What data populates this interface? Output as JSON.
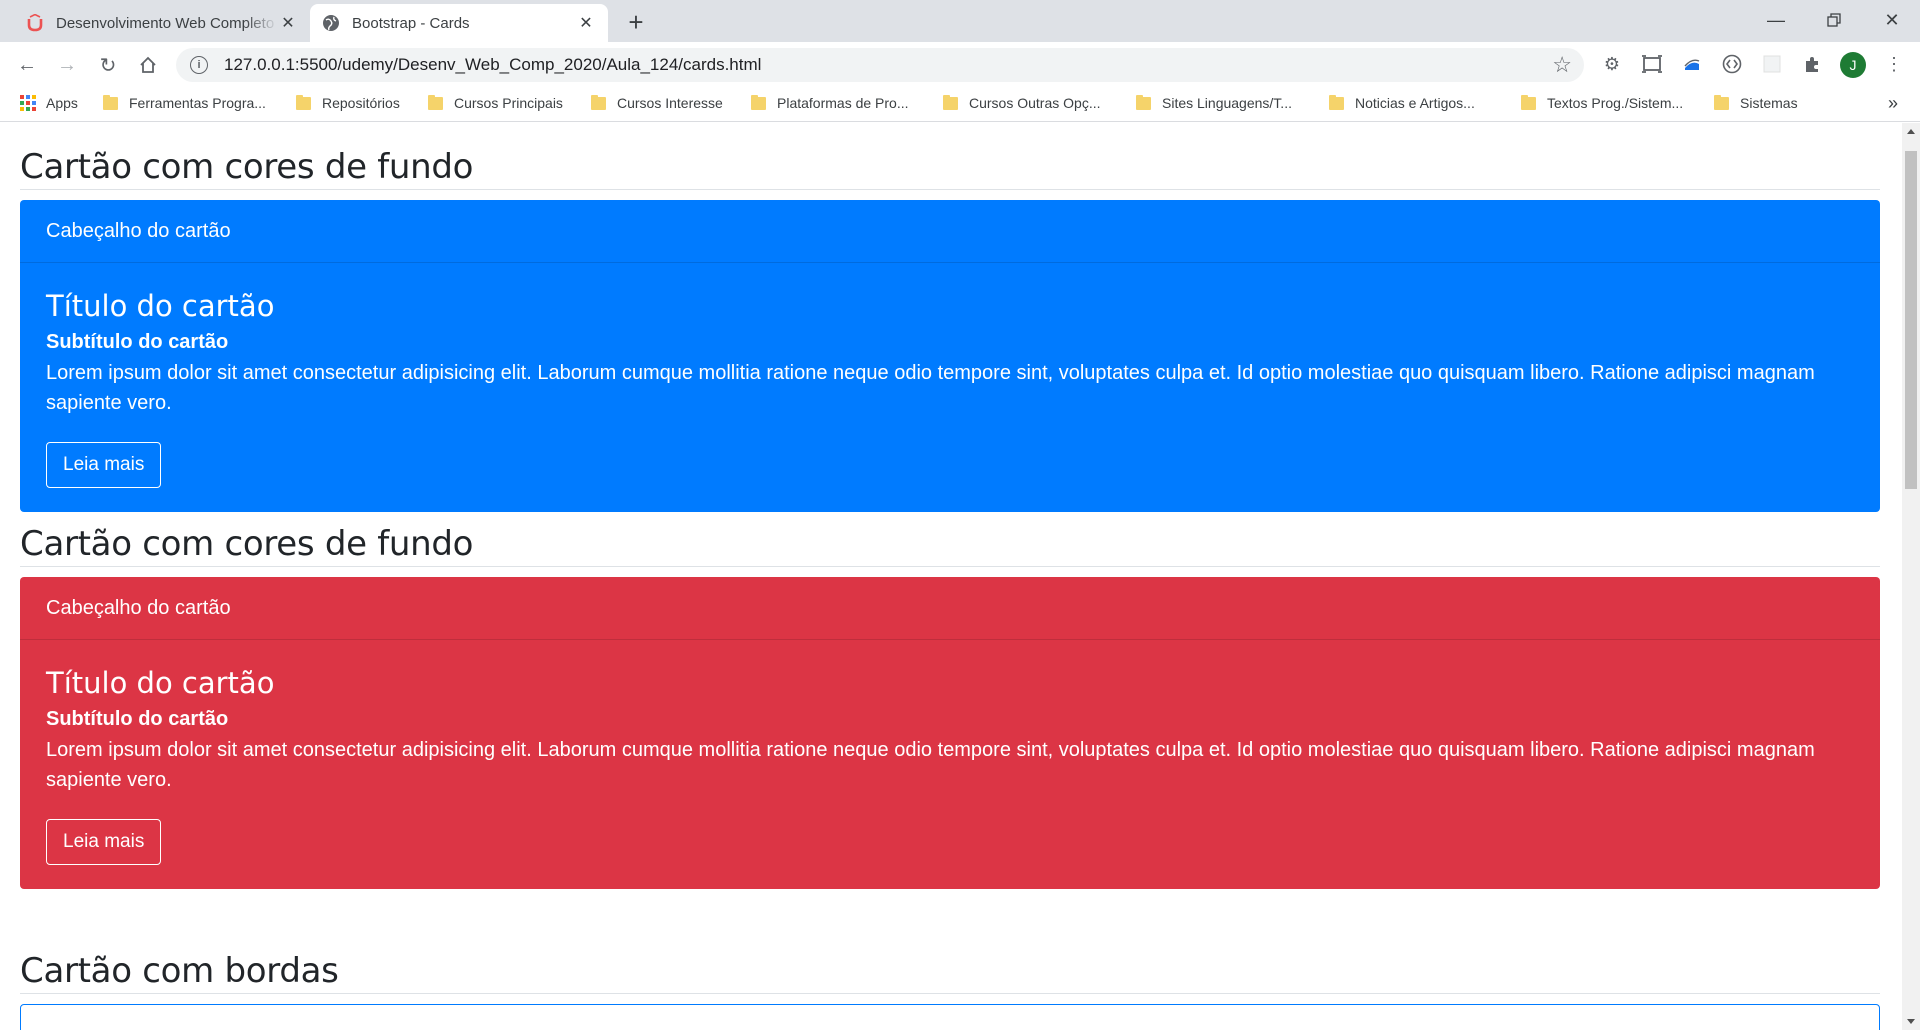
{
  "browser": {
    "tabs": [
      {
        "title": "Desenvolvimento Web Completo"
      },
      {
        "title": "Bootstrap - Cards"
      }
    ],
    "url": "127.0.0.1:5500/udemy/Desenv_Web_Comp_2020/Aula_124/cards.html",
    "profile_initial": "J",
    "bookmarks": [
      {
        "label": "Apps",
        "icon": "apps-grid-icon"
      },
      {
        "label": "Ferramentas Progra...",
        "icon": "folder-icon"
      },
      {
        "label": "Repositórios",
        "icon": "folder-icon"
      },
      {
        "label": "Cursos Principais",
        "icon": "folder-icon"
      },
      {
        "label": "Cursos Interesse",
        "icon": "folder-icon"
      },
      {
        "label": "Plataformas de Pro...",
        "icon": "folder-icon"
      },
      {
        "label": "Cursos Outras Opç...",
        "icon": "folder-icon"
      },
      {
        "label": "Sites Linguagens/T...",
        "icon": "folder-icon"
      },
      {
        "label": "Noticias e Artigos...",
        "icon": "folder-icon"
      },
      {
        "label": "Textos Prog./Sistem...",
        "icon": "folder-icon"
      },
      {
        "label": "Sistemas",
        "icon": "folder-icon"
      }
    ],
    "more_bookmarks": "»"
  },
  "page": {
    "sections": [
      {
        "title": "Cartão com cores de fundo",
        "card": {
          "color": "#007bff",
          "header": "Cabeçalho do cartão",
          "title": "Título do cartão",
          "subtitle": "Subtítulo do cartão",
          "text": "Lorem ipsum dolor sit amet consectetur adipisicing elit. Laborum cumque mollitia ratione neque odio tempore sint, voluptates culpa et. Id optio molestiae quo quisquam libero. Ratione adipisci magnam sapiente vero.",
          "button": "Leia mais"
        }
      },
      {
        "title": "Cartão com cores de fundo",
        "card": {
          "color": "#dc3545",
          "header": "Cabeçalho do cartão",
          "title": "Título do cartão",
          "subtitle": "Subtítulo do cartão",
          "text": "Lorem ipsum dolor sit amet consectetur adipisicing elit. Laborum cumque mollitia ratione neque odio tempore sint, voluptates culpa et. Id optio molestiae quo quisquam libero. Ratione adipisci magnam sapiente vero.",
          "button": "Leia mais"
        }
      },
      {
        "title": "Cartão com bordas",
        "border_color": "#007bff"
      }
    ]
  }
}
